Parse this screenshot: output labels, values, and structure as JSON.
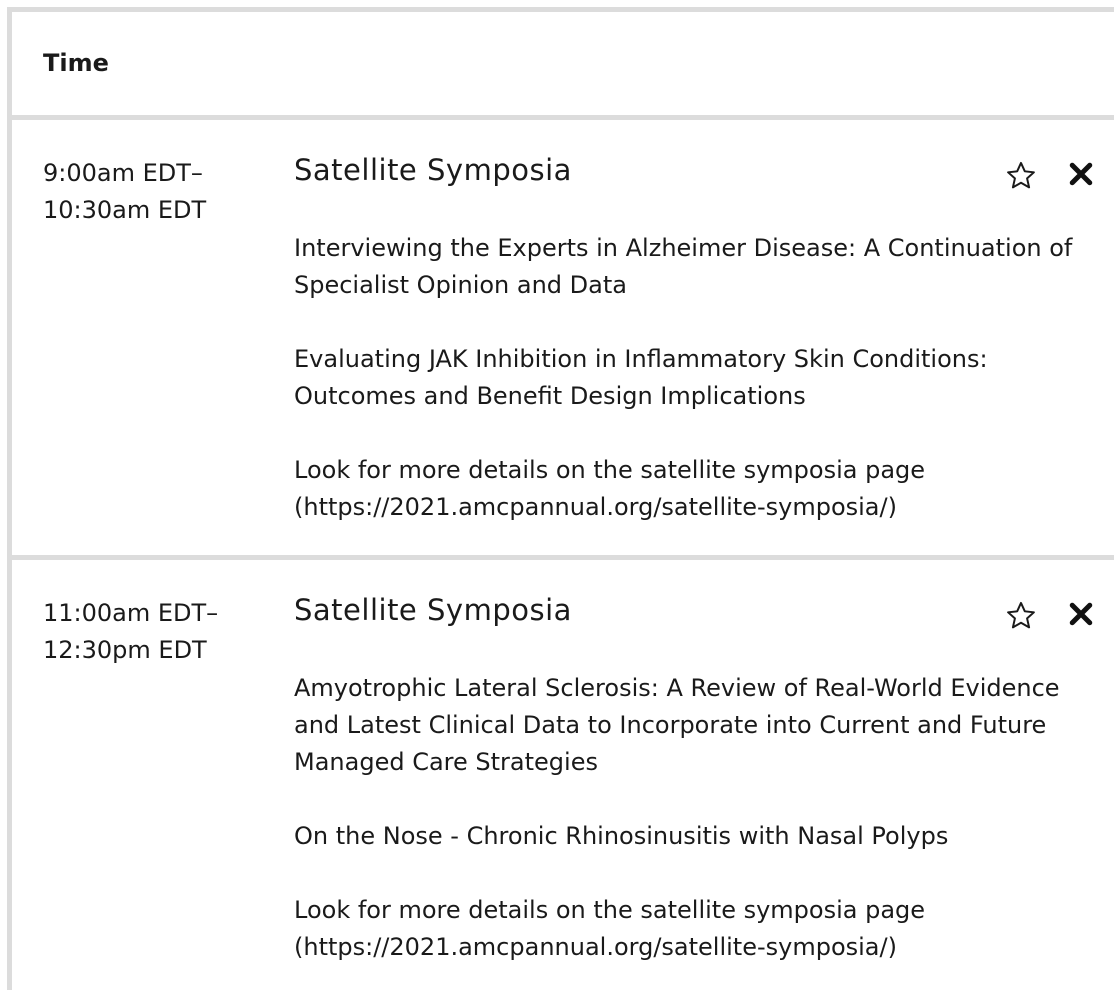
{
  "table": {
    "header_time": "Time"
  },
  "sessions": [
    {
      "time_start": "9:00am EDT–",
      "time_end": "10:30am EDT",
      "title": "Satellite Symposia",
      "items": [
        "Interviewing the Experts in Alzheimer Disease: A Continuation of Specialist Opinion and Data",
        "Evaluating JAK Inhibition in Inflammatory Skin Conditions: Outcomes and Benefit Design Implications",
        "Look for more details on the satellite symposia page (https://2021.amcpannual.org/satellite-symposia/)"
      ],
      "icons": [
        "star-icon",
        "close-icon"
      ]
    },
    {
      "time_start": "11:00am EDT–",
      "time_end": "12:30pm EDT",
      "title": "Satellite Symposia",
      "items": [
        "Amyotrophic Lateral Sclerosis: A Review of Real-World Evidence and Latest Clinical Data to Incorporate into Current and Future Managed Care Strategies",
        "On the Nose - Chronic Rhinosinusitis with Nasal Polyps",
        "Look for more details on the satellite symposia page (https://2021.amcpannual.org/satellite-symposia/)"
      ],
      "icons": [
        "star-icon",
        "close-icon"
      ]
    }
  ],
  "colors": {
    "divider": "#dcdcdc",
    "text": "#1a1a1a"
  }
}
